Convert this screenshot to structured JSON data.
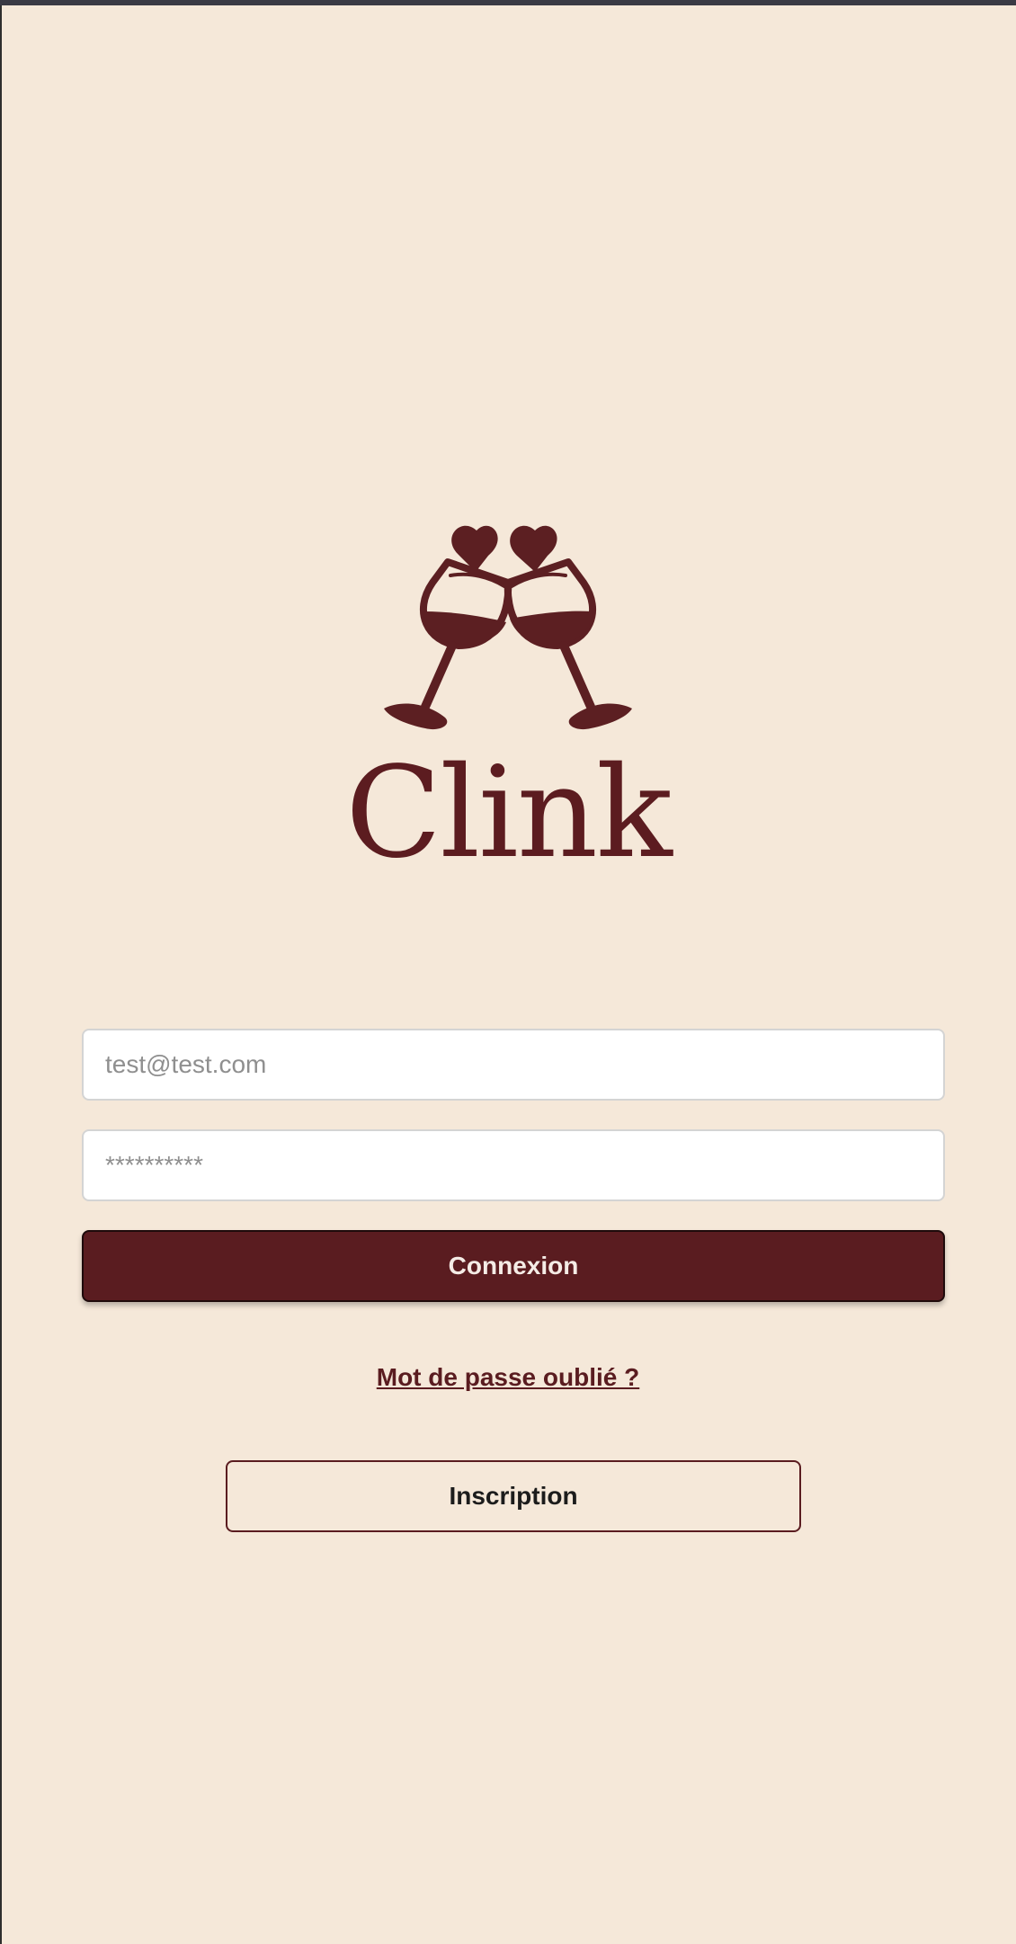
{
  "app": {
    "brand_name": "Clink"
  },
  "login_form": {
    "email_placeholder": "test@test.com",
    "password_placeholder": "**********",
    "login_button_label": "Connexion",
    "forgot_password_label": "Mot de passe oublié ?",
    "signup_button_label": "Inscription"
  },
  "icons": {
    "logo": "clinking-wine-glasses-hearts-icon"
  },
  "colors": {
    "background": "#f5e8d9",
    "brand": "#5a1c20",
    "input_background": "#ffffff"
  }
}
